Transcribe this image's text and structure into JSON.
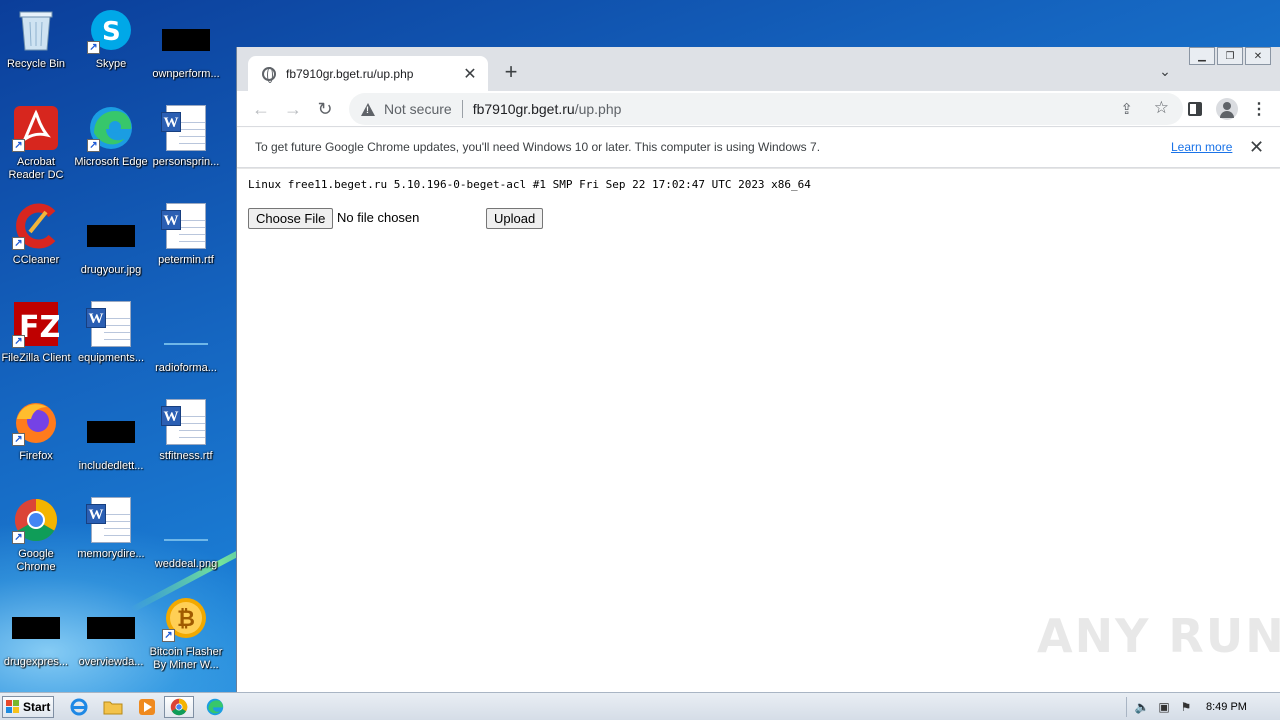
{
  "desktop": {
    "icons": [
      {
        "label": "Recycle Bin"
      },
      {
        "label": "Skype"
      },
      {
        "label": "ownperform..."
      },
      {
        "label": "Acrobat Reader DC"
      },
      {
        "label": "Microsoft Edge"
      },
      {
        "label": "personsprin..."
      },
      {
        "label": "CCleaner"
      },
      {
        "label": "drugyour.jpg"
      },
      {
        "label": "petermin.rtf"
      },
      {
        "label": "FileZilla Client"
      },
      {
        "label": "equipments..."
      },
      {
        "label": "radioforma..."
      },
      {
        "label": "Firefox"
      },
      {
        "label": "includedlett..."
      },
      {
        "label": "stfitness.rtf"
      },
      {
        "label": "Google Chrome"
      },
      {
        "label": "memorydire..."
      },
      {
        "label": "weddeal.png"
      },
      {
        "label": "drugexpres..."
      },
      {
        "label": "overviewda..."
      },
      {
        "label": "Bitcoin Flasher By Miner W..."
      }
    ]
  },
  "browser": {
    "tab_title": "fb7910gr.bget.ru/up.php",
    "tab_close": "✕",
    "new_tab": "+",
    "not_secure": "Not secure",
    "url_host": "fb7910gr.bget.ru",
    "url_path": "/up.php",
    "infobar_message": "To get future Google Chrome updates, you'll need Windows 10 or later. This computer is using Windows 7.",
    "infobar_link": "Learn more",
    "infobar_close": "✕"
  },
  "page": {
    "uname": "Linux free11.beget.ru 5.10.196-0-beget-acl #1 SMP Fri Sep 22 17:02:47 UTC 2023 x86_64",
    "choose_file_label": "Choose File",
    "no_file_text": "No file chosen",
    "upload_label": "Upload"
  },
  "watermark": "ANY RUN",
  "taskbar": {
    "start_label": "Start",
    "clock": "8:49 PM"
  },
  "colors": {
    "chrome_frame": "#dee1e6",
    "link_blue": "#1a73e8",
    "wallpaper": "#1565c0"
  }
}
